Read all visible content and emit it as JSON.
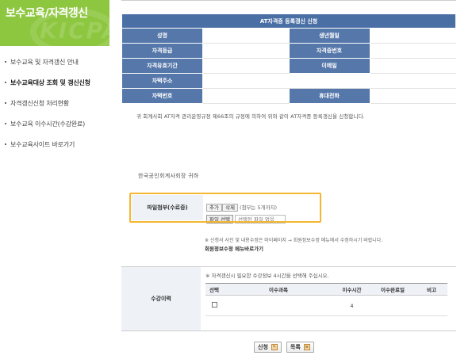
{
  "sidebar": {
    "title": "보수교육/자격갱신",
    "watermark": "KICPA",
    "items": [
      {
        "label": "보수교육 및 자격갱신 안내",
        "active": false
      },
      {
        "label": "보수교육대상 조회 및 갱신신청",
        "active": true
      },
      {
        "label": "자격갱신신청 처리현황",
        "active": false
      },
      {
        "label": "보수교육 이수시간(수강완료)",
        "active": false
      },
      {
        "label": "보수교육사이트 바로가기",
        "active": false
      }
    ]
  },
  "form": {
    "title": "AT자격증 등록갱신 신청",
    "rows": [
      {
        "l1": "성명",
        "l2": "생년월일"
      },
      {
        "l1": "자격등급",
        "l2": "자격증번호"
      },
      {
        "l1": "자격유효기간",
        "l2": "이메일"
      },
      {
        "l1": "자택주소",
        "l2": ""
      },
      {
        "l1": "자택번호",
        "l2": "휴대전화"
      }
    ],
    "notice": "귀 회계사회 AT자격 관리운영규정 제66조의 규정에 의하여 위와 같이 AT자격증 등록갱신을 신청합니다.",
    "addressee": "한국공인회계사회장  귀하"
  },
  "attachment": {
    "label": "파일첨부(수료증)",
    "add_label": "추가",
    "delete_label": "삭제",
    "hint": "(첨부는 5개까지)",
    "file_button": "파일 선택",
    "file_status": "선택된 파일 없음"
  },
  "member_notice": "※ 신청서 사진 및 내용수정은 마이페이지 → 회원정보수정 메뉴에서 수정하시기 바랍니다.",
  "member_link": "회원정보수정 메뉴바로가기",
  "history": {
    "label": "수강이력",
    "note": "※ 자격갱신시 필요한 수강정보 4시간을 선택해 주십시오.",
    "columns": [
      "선택",
      "이수과목",
      "이수시간",
      "이수완료일",
      "비고"
    ],
    "rows": [
      {
        "subject": "",
        "hours": "4",
        "completed": "",
        "remark": ""
      }
    ]
  },
  "buttons": {
    "apply": "신청",
    "list": "목록"
  }
}
